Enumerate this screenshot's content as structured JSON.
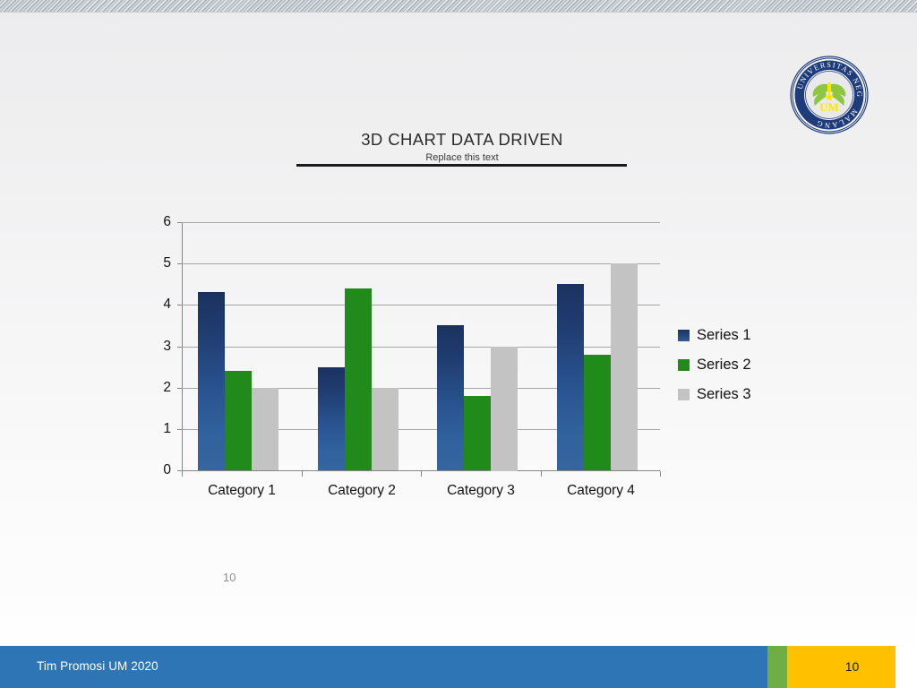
{
  "slide": {
    "title": "3D CHART DATA DRIVEN",
    "subtitle": "Replace this text",
    "body_slide_number": "10"
  },
  "logo": {
    "name": "universitas-negeri-malang-logo",
    "ring_text_top": "UNIVERSITAS",
    "ring_text_upper": "NEGERI",
    "ring_text_right": "MALANG",
    "monogram": "UM",
    "colors": {
      "ring": "#1f3c7a",
      "emblem": "#8dc63f",
      "flame": "#ffe600"
    }
  },
  "footer": {
    "text": "Tim Promosi UM 2020",
    "slide_number": "10",
    "colors": {
      "bar": "#2e75b6",
      "divider": "#6fae45",
      "number_box": "#ffc000"
    }
  },
  "chart_data": {
    "type": "bar",
    "title": "3D CHART DATA DRIVEN",
    "subtitle": "Replace this text",
    "xlabel": "",
    "ylabel": "",
    "categories": [
      "Category 1",
      "Category 2",
      "Category 3",
      "Category 4"
    ],
    "series": [
      {
        "name": "Series 1",
        "color": "#1f3c70",
        "values": [
          4.3,
          2.5,
          3.5,
          4.5
        ]
      },
      {
        "name": "Series 2",
        "color": "#208a1b",
        "values": [
          2.4,
          4.4,
          1.8,
          2.8
        ]
      },
      {
        "name": "Series 3",
        "color": "#c3c3c3",
        "values": [
          2.0,
          2.0,
          3.0,
          5.0
        ]
      }
    ],
    "ylim": [
      0,
      6
    ],
    "yticks": [
      0,
      1,
      2,
      3,
      4,
      5,
      6
    ],
    "ytick_labels": [
      "0",
      "1",
      "2",
      "3",
      "4",
      "5",
      "6"
    ],
    "grid": true,
    "grid_axis": "y",
    "legend_position": "right"
  }
}
